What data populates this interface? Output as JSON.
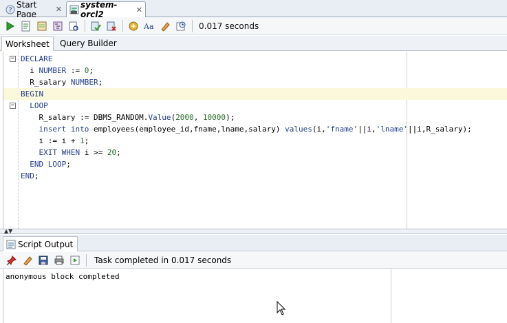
{
  "doc_tabs": [
    {
      "label": "Start Page",
      "icon": "help-icon"
    },
    {
      "label": "system-orcl2",
      "icon": "sql-worksheet-icon"
    }
  ],
  "toolbar": {
    "buttons": [
      "run-statement-icon",
      "run-script-icon",
      "autotrace-icon",
      "explain-plan-icon",
      "sql-tuning-icon",
      "commit-icon",
      "rollback-icon",
      "unshared-sql-icon",
      "to-upper-lower-icon",
      "clear-icon",
      "sql-history-icon"
    ],
    "timing": "0.017 seconds"
  },
  "subtabs": [
    "Worksheet",
    "Query Builder"
  ],
  "code_lines": [
    {
      "fold": "−",
      "parts": [
        {
          "t": "DECLARE",
          "k": "kw"
        }
      ]
    },
    {
      "fold": "",
      "parts": [
        {
          "t": "  i ",
          "k": ""
        },
        {
          "t": "NUMBER",
          "k": "kw"
        },
        {
          "t": " := ",
          "k": ""
        },
        {
          "t": "0",
          "k": "num"
        },
        {
          "t": ";",
          "k": ""
        }
      ]
    },
    {
      "fold": "",
      "parts": [
        {
          "t": "  R_salary ",
          "k": ""
        },
        {
          "t": "NUMBER",
          "k": "kw"
        },
        {
          "t": ";",
          "k": ""
        }
      ]
    },
    {
      "fold": "",
      "parts": [
        {
          "t": "BEGIN",
          "k": "kw"
        }
      ]
    },
    {
      "fold": "−",
      "parts": [
        {
          "t": "  LOOP",
          "k": "kw"
        }
      ]
    },
    {
      "fold": "",
      "parts": [
        {
          "t": "    R_salary := DBMS_RANDOM.",
          "k": ""
        },
        {
          "t": "Value",
          "k": "kw"
        },
        {
          "t": "(",
          "k": ""
        },
        {
          "t": "2000",
          "k": "num"
        },
        {
          "t": ", ",
          "k": ""
        },
        {
          "t": "10000",
          "k": "num"
        },
        {
          "t": ");",
          "k": ""
        }
      ]
    },
    {
      "fold": "",
      "parts": [
        {
          "t": "    ",
          "k": ""
        },
        {
          "t": "insert into",
          "k": "kw"
        },
        {
          "t": " employees(employee_id,fname,lname,salary) ",
          "k": ""
        },
        {
          "t": "values",
          "k": "kw"
        },
        {
          "t": "(i,",
          "k": ""
        },
        {
          "t": "'fname'",
          "k": "str"
        },
        {
          "t": "||i,",
          "k": ""
        },
        {
          "t": "'lname'",
          "k": "str"
        },
        {
          "t": "||i,R_salary);",
          "k": ""
        }
      ]
    },
    {
      "fold": "",
      "parts": [
        {
          "t": "    i := i + ",
          "k": ""
        },
        {
          "t": "1",
          "k": "num"
        },
        {
          "t": ";",
          "k": ""
        }
      ]
    },
    {
      "fold": "",
      "parts": [
        {
          "t": "    ",
          "k": ""
        },
        {
          "t": "EXIT WHEN",
          "k": "kw"
        },
        {
          "t": " i >= ",
          "k": ""
        },
        {
          "t": "20",
          "k": "num"
        },
        {
          "t": ";",
          "k": ""
        }
      ]
    },
    {
      "fold": "",
      "parts": [
        {
          "t": "  ",
          "k": ""
        },
        {
          "t": "END LOOP",
          "k": "kw"
        },
        {
          "t": ";",
          "k": ""
        }
      ]
    },
    {
      "fold": "",
      "parts": [
        {
          "t": "END",
          "k": "kw"
        },
        {
          "t": ";",
          "k": ""
        }
      ]
    }
  ],
  "highlighted_line": 3,
  "output_panel": {
    "tab_label": "Script Output",
    "buttons": [
      "pin-icon",
      "clear-output-icon",
      "save-icon",
      "print-icon",
      "open-in-editor-icon"
    ],
    "status": "Task completed in 0.017 seconds",
    "text": "anonymous block completed"
  }
}
